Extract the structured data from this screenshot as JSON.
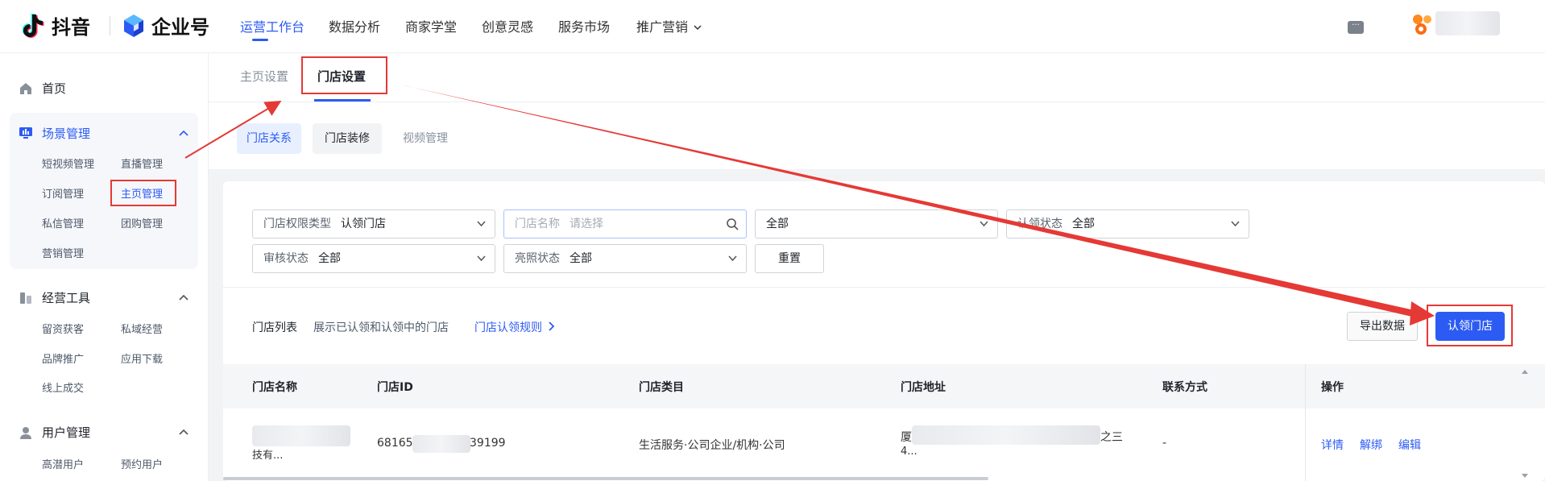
{
  "header": {
    "douyin_label": "抖音",
    "enterprise_label": "企业号",
    "nav": [
      {
        "label": "运营工作台",
        "active": true
      },
      {
        "label": "数据分析"
      },
      {
        "label": "商家学堂"
      },
      {
        "label": "创意灵感"
      },
      {
        "label": "服务市场"
      },
      {
        "label": "推广营销"
      }
    ],
    "chat_glyph": "···"
  },
  "sidebar": {
    "home": "首页",
    "scene": {
      "title": "场景管理",
      "items": [
        "短视频管理",
        "直播管理",
        "订阅管理",
        "主页管理",
        "私信管理",
        "团购管理",
        "营销管理"
      ]
    },
    "tools": {
      "title": "经营工具",
      "items": [
        "留资获客",
        "私域经营",
        "品牌推广",
        "应用下载",
        "线上成交"
      ]
    },
    "users": {
      "title": "用户管理",
      "items": [
        "高潜用户",
        "预约用户"
      ]
    }
  },
  "page_tabs": [
    "主页设置",
    "门店设置"
  ],
  "sub_tabs": [
    "门店关系",
    "门店装修",
    "视频管理"
  ],
  "filters": {
    "perm_type_label": "门店权限类型",
    "perm_type_value": "认领门店",
    "store_name_label": "门店名称",
    "store_name_placeholder": "请选择",
    "all_value": "全部",
    "auth_status_label": "认领状态",
    "auth_status_value": "全部",
    "review_label": "审核状态",
    "review_value": "全部",
    "license_label": "亮照状态",
    "license_value": "全部",
    "reset": "重置"
  },
  "list": {
    "title": "门店列表",
    "desc": "展示已认领和认领中的门店",
    "rule_link": "门店认领规则",
    "export": "导出数据",
    "claim": "认领门店"
  },
  "table": {
    "headers": [
      "门店名称",
      "门店ID",
      "门店类目",
      "门店地址",
      "联系方式",
      "操作"
    ],
    "row": {
      "name": "技有...",
      "id_prefix": "681659",
      "id_suffix": "39199",
      "category": "生活服务·公司企业/机构·公司",
      "addr_line1_start": "厦",
      "addr_line1_end": "之三",
      "addr_line2": "4...",
      "contact": "-",
      "actions": [
        "详情",
        "解绑",
        "编辑"
      ]
    }
  }
}
